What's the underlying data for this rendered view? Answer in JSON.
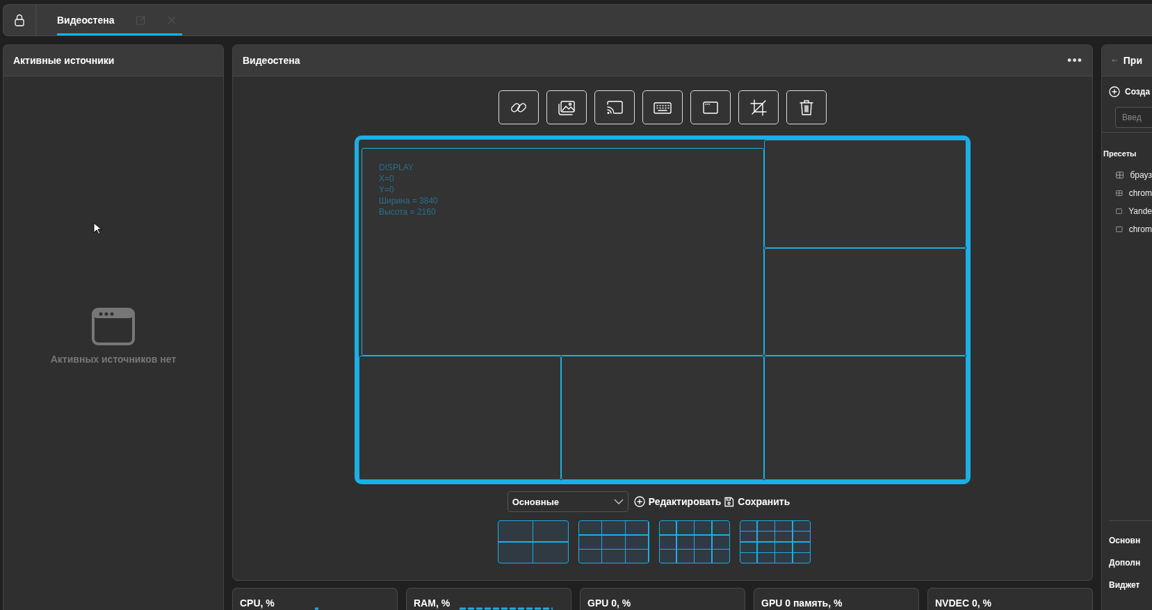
{
  "top_bar": {
    "tabs": [
      {
        "label": "Видеостена",
        "selected": true
      }
    ]
  },
  "active_sources": {
    "title": "Активные источники",
    "empty_text": "Активных источников нет"
  },
  "video_wall": {
    "title": "Видеостена",
    "menu": "•••",
    "cells": [
      {
        "kind": "main",
        "lines": [
          "DISPLAY",
          "X=0",
          "Y=0",
          "Ширина = 3840",
          "Высота = 2160"
        ]
      },
      {
        "kind": "tile"
      },
      {
        "kind": "tile"
      },
      {
        "kind": "tile"
      },
      {
        "kind": "tile"
      },
      {
        "kind": "tile"
      }
    ],
    "layout_select": {
      "value": "Основные"
    },
    "actions": [
      {
        "kind": "add",
        "label": "Редактировать"
      },
      {
        "kind": "save",
        "label": "Сохранить"
      }
    ],
    "layouts": [
      {
        "kind": "quad"
      },
      {
        "kind": "nine"
      },
      {
        "kind": "twelve"
      },
      {
        "kind": "sixteen"
      }
    ]
  },
  "stats": [
    {
      "label": "CPU, %",
      "graph": true
    },
    {
      "label": "RAM, %",
      "graph": true
    },
    {
      "label": "GPU 0, %",
      "graph": false
    },
    {
      "label": "GPU 0 память, %",
      "graph": false
    },
    {
      "label": "NVDEC 0, %",
      "graph": false
    }
  ],
  "right_panel": {
    "title": "При",
    "create": "Созда",
    "search": {
      "placeholder": "Введ"
    },
    "presets_title": "Пресеты",
    "presets": [
      {
        "kind": "grid",
        "label": "брауз"
      },
      {
        "kind": "grid",
        "label": "chrom"
      },
      {
        "kind": "window",
        "label": "Yande"
      },
      {
        "kind": "window",
        "label": "chrom"
      }
    ],
    "sections": [
      "Основн",
      "Дополн",
      "Виджет"
    ]
  }
}
